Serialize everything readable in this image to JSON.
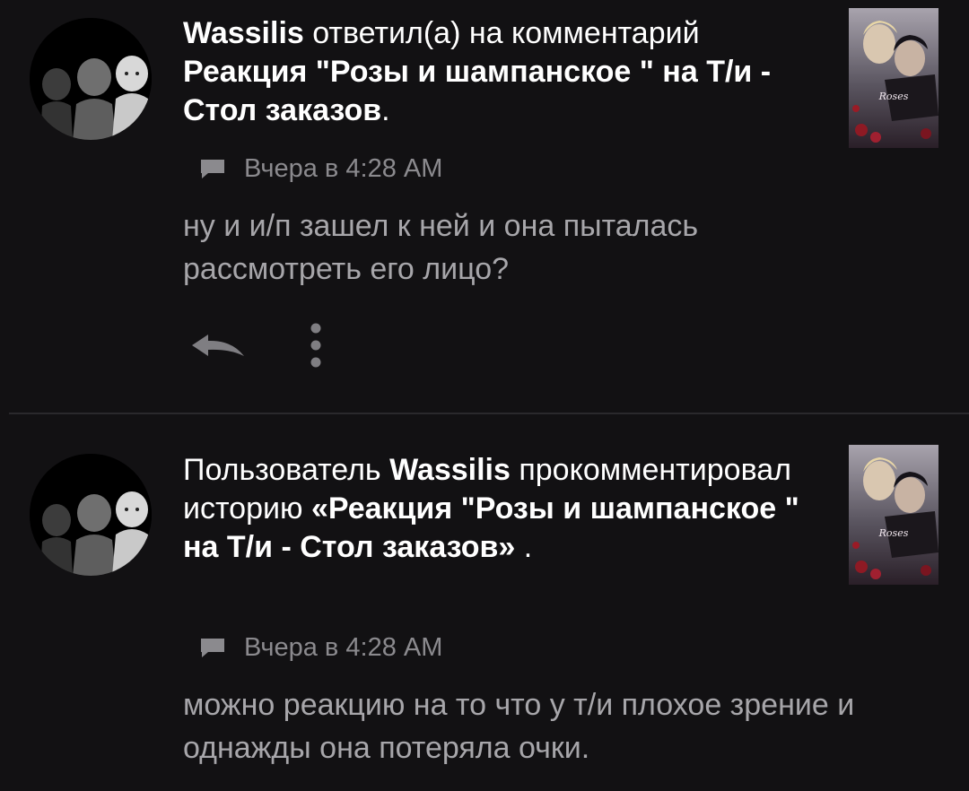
{
  "notifications": [
    {
      "headline": {
        "user": "Wassilis",
        "action": " ответил(а) на комментарий ",
        "story": "Реакция \"Розы и шампанское \" на Т/и - Стол заказов",
        "suffix": "."
      },
      "time": "Вчера в 4:28 AM",
      "message": "ну и и/п зашел к ней и она пыталась рассмотреть его лицо?",
      "actions": {
        "reply_icon": "reply-arrow-icon",
        "more_icon": "more-vertical-icon"
      }
    },
    {
      "headline": {
        "prefix": "Пользователь ",
        "user": "Wassilis",
        "action": " прокомментировал историю ",
        "story": "«Реакция \"Розы и шампанское \" на Т/и - Стол заказов»",
        "suffix": " ."
      },
      "time": "Вчера в 4:28 AM",
      "message": "можно реакцию на то что у т/и плохое зрение и однажды она потеряла очки."
    }
  ],
  "colors": {
    "background": "#121113",
    "primary_text": "#ffffff",
    "secondary_text": "#a7a6aa",
    "meta_text": "#8b8a8e",
    "divider": "#2a292c"
  }
}
